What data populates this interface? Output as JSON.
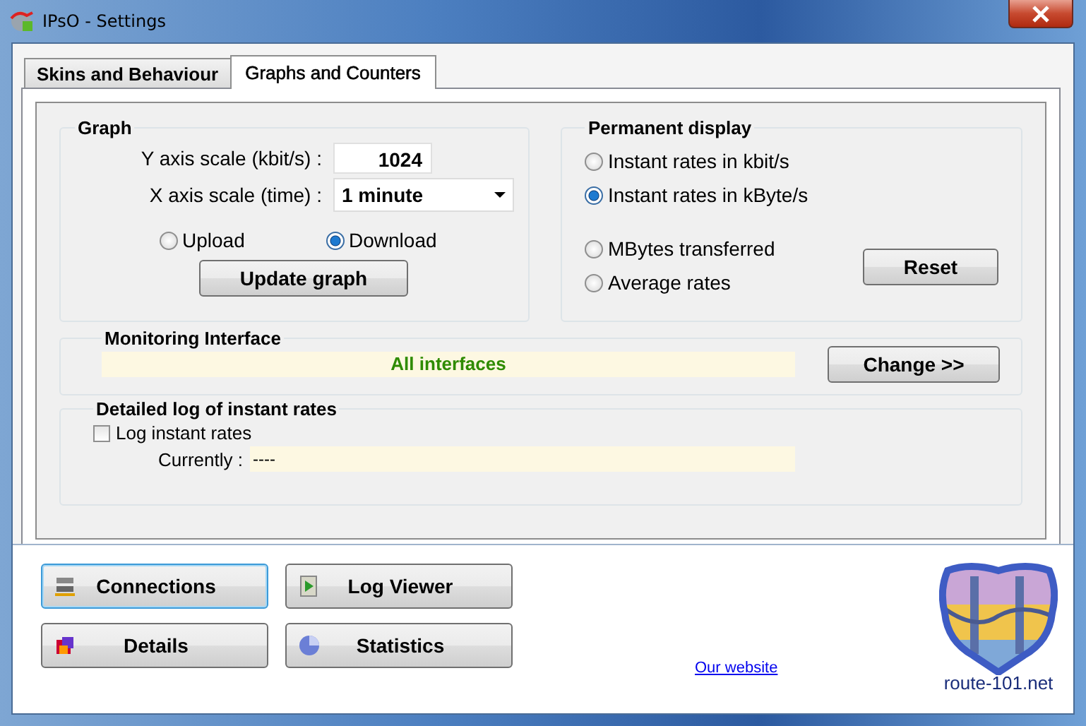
{
  "window": {
    "title": "IPsO - Settings"
  },
  "tabs": [
    {
      "label": "Skins and Behaviour",
      "selected": false
    },
    {
      "label": "Graphs and Counters",
      "selected": true
    }
  ],
  "graph": {
    "title": "Graph",
    "y_axis_label": "Y axis scale (kbit/s) :",
    "y_axis_value": "1024",
    "x_axis_label": "X axis scale (time) :",
    "x_axis_value": "1 minute",
    "directions": [
      {
        "label": "Upload",
        "selected": false
      },
      {
        "label": "Download",
        "selected": true
      }
    ],
    "update_button": "Update graph"
  },
  "permanent_display": {
    "title": "Permanent display",
    "options": [
      {
        "label": "Instant rates in kbit/s",
        "selected": false
      },
      {
        "label": "Instant rates in kByte/s",
        "selected": true
      },
      {
        "label": "MBytes transferred",
        "selected": false
      },
      {
        "label": "Average rates",
        "selected": false
      }
    ],
    "reset_button": "Reset"
  },
  "monitoring_interface": {
    "title": "Monitoring Interface",
    "value": "All interfaces",
    "change_button": "Change >>"
  },
  "detailed_log": {
    "title": "Detailed log of instant rates",
    "checkbox": {
      "label": "Log instant rates",
      "checked": false
    },
    "currently_label": "Currently :",
    "currently_value": "----"
  },
  "bottom_buttons": [
    {
      "label": "Connections",
      "kind": "network",
      "focused": true
    },
    {
      "label": "Log Viewer",
      "kind": "log",
      "focused": false
    },
    {
      "label": "Details",
      "kind": "details",
      "focused": false
    },
    {
      "label": "Statistics",
      "kind": "statistics",
      "focused": false
    }
  ],
  "website_link": "Our website",
  "logo_caption": "route-101.net"
}
